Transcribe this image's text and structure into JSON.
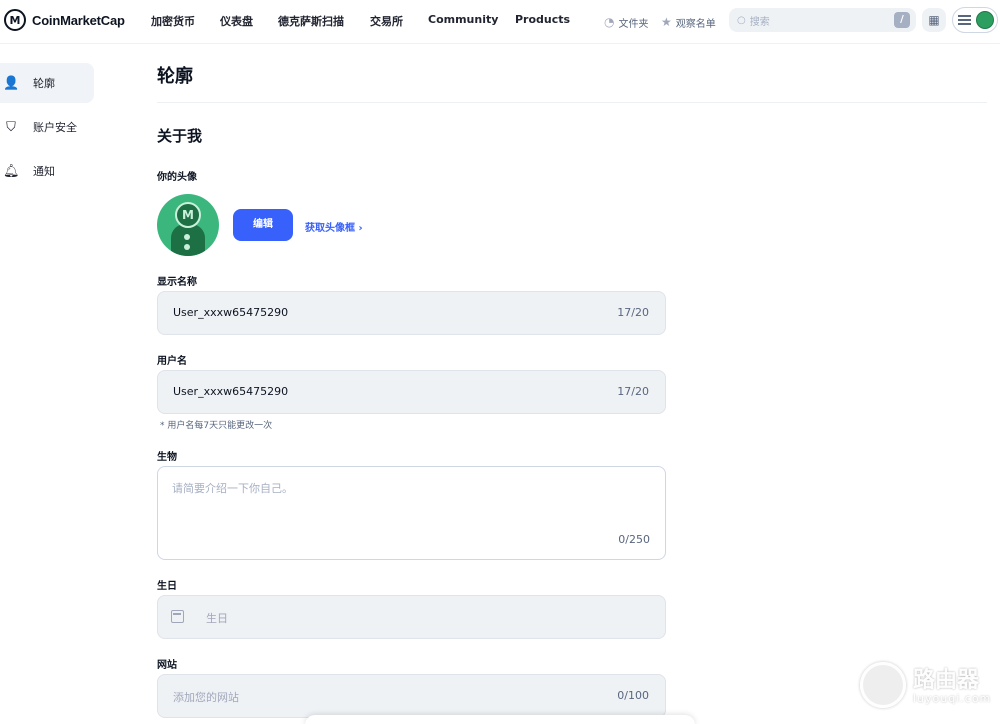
{
  "header": {
    "logo_text": "CoinMarketCap",
    "nav": [
      "加密货币",
      "仪表盘",
      "德克萨斯扫描",
      "交易所",
      "Community",
      "Products"
    ],
    "portfolio_label": "文件夹",
    "watchlist_label": "观察名单",
    "search_placeholder": "搜索",
    "search_shortcut": "/"
  },
  "sidebar": {
    "items": [
      {
        "label": "轮廓",
        "icon": "user-icon",
        "active": true
      },
      {
        "label": "账户安全",
        "icon": "shield-icon",
        "active": false
      },
      {
        "label": "通知",
        "icon": "bell-icon",
        "active": false
      }
    ]
  },
  "main": {
    "page_title": "轮廓",
    "section_title": "关于我",
    "avatar_label": "你的头像",
    "edit_button": "编辑",
    "get_frame_link": "获取头像框 ›",
    "display_name": {
      "label": "显示名称",
      "value": "User_xxxw65475290",
      "count": "17/20"
    },
    "username": {
      "label": "用户名",
      "value": "User_xxxw65475290",
      "count": "17/20",
      "hint": "* 用户名每7天只能更改一次"
    },
    "bio": {
      "label": "生物",
      "placeholder": "请简要介绍一下你自己。",
      "count": "0/250"
    },
    "birthday": {
      "label": "生日",
      "placeholder": "生日"
    },
    "website": {
      "label": "网站",
      "placeholder": "添加您的网站",
      "count": "0/100"
    }
  },
  "watermark": {
    "text": "路由器",
    "sub": "luyouqi.com"
  },
  "colors": {
    "accent": "#3861fb",
    "input_bg": "#eff2f5",
    "text": "#0d1421",
    "muted": "#58667e"
  }
}
